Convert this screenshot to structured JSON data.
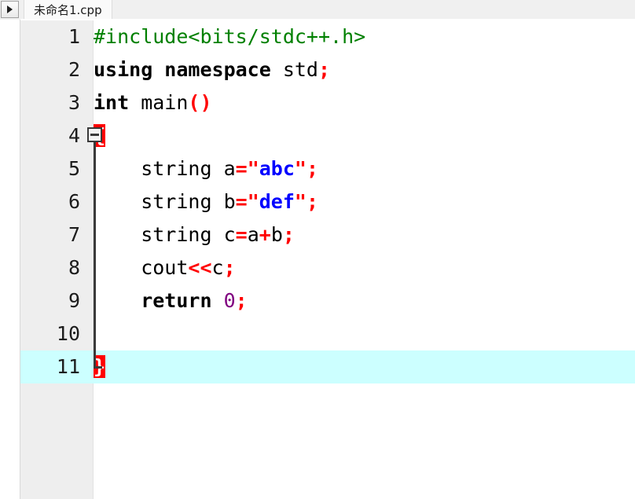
{
  "window": {
    "title": "未命名1.cpp"
  },
  "left_panel": {
    "scroll_button": {
      "icon": "triangle-right-icon",
      "label": ""
    }
  },
  "tabbar": {
    "tabs": [
      {
        "label": "未命名1.cpp",
        "active": true
      }
    ]
  },
  "editor": {
    "current_line": 11,
    "colors": {
      "preprocessor": "#008000",
      "keyword": "#000000",
      "identifier": "#000000",
      "operator": "#ff0000",
      "string": "#0000ff",
      "quote": "#ff0000",
      "number": "#800080",
      "brace_match_bg": "#ff0000",
      "brace_match_fg": "#ffffff",
      "current_line_bg": "#ccffff",
      "gutter_bg": "#eeeeee",
      "editor_bg": "#ffffff"
    },
    "lines": [
      {
        "num": "1",
        "text": "#include<bits/stdc++.h>"
      },
      {
        "num": "2",
        "text": "using namespace std;"
      },
      {
        "num": "3",
        "text": "int main()"
      },
      {
        "num": "4",
        "text": "{"
      },
      {
        "num": "5",
        "text": "    string a=\"abc\";"
      },
      {
        "num": "6",
        "text": "    string b=\"def\";"
      },
      {
        "num": "7",
        "text": "    string c=a+b;"
      },
      {
        "num": "8",
        "text": "    cout<<c;"
      },
      {
        "num": "9",
        "text": "    return 0;"
      },
      {
        "num": "10",
        "text": ""
      },
      {
        "num": "11",
        "text": "}"
      }
    ],
    "folding": {
      "start_line": "4",
      "end_line": "11",
      "marker": "minus-box-icon"
    }
  }
}
